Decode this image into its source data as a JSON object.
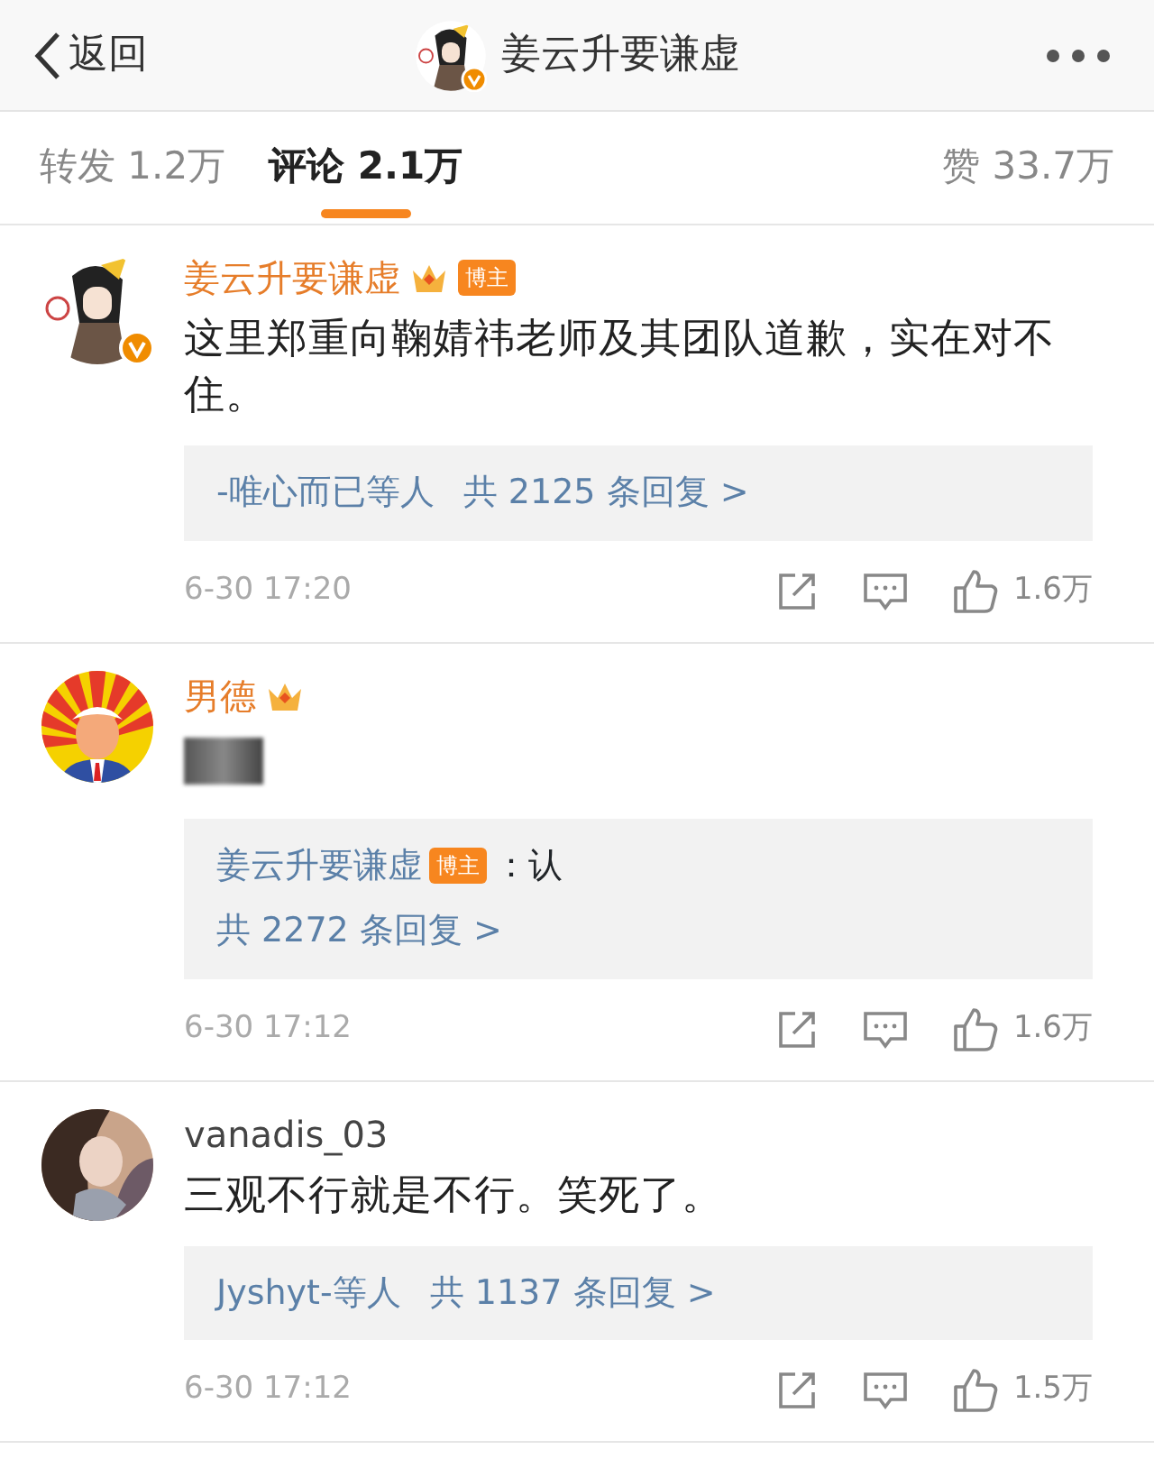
{
  "header": {
    "back_label": "返回",
    "title": "姜云升要谦虚"
  },
  "tabs": [
    {
      "label": "转发 1.2万",
      "selected": false
    },
    {
      "label": "评论 2.1万",
      "selected": true
    },
    {
      "label": "赞 33.7万",
      "selected": false
    }
  ],
  "comments": [
    {
      "author": "姜云升要谦虚",
      "verified": true,
      "crown": true,
      "badge": "博主",
      "text": "这里郑重向鞠婧祎老师及其团队道歉，实在对不住。",
      "redacted": false,
      "reply_box": {
        "kind": "summary",
        "names": "-唯心而已等人",
        "count": "共 2125 条回复 >"
      },
      "time": "6-30 17:20",
      "likes": "1.6万"
    },
    {
      "author": "男德",
      "verified": false,
      "crown": true,
      "redacted": true,
      "reply_box": {
        "kind": "quote",
        "author": "姜云升要谦虚",
        "badge": "博主",
        "text": "：认",
        "count": "共 2272 条回复 >"
      },
      "time": "6-30 17:12",
      "likes": "1.6万"
    },
    {
      "author": "vanadis_03",
      "verified": false,
      "crown": false,
      "text": "三观不行就是不行。笑死了。",
      "redacted": false,
      "reply_box": {
        "kind": "summary",
        "names": "Jyshyt-等人",
        "count": "共 1137 条回复 >"
      },
      "time": "6-30 17:12",
      "likes": "1.5万"
    }
  ]
}
